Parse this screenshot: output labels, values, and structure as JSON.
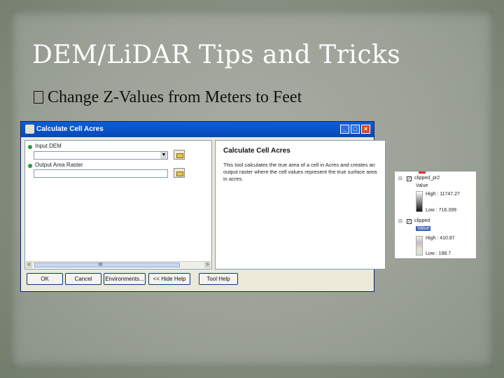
{
  "slide": {
    "title": "DEM/LiDAR Tips and Tricks",
    "bullet_mark": "",
    "bullet_text": "Change Z-Values from Meters to Feet"
  },
  "dialog": {
    "title": "Calculate Cell Acres",
    "window_buttons": [
      "_",
      "□",
      "×"
    ],
    "params": [
      {
        "label": "Input DEM",
        "value": "",
        "has_dropdown": true
      },
      {
        "label": "Output Area Raster",
        "value": "",
        "has_dropdown": false
      }
    ],
    "help": {
      "title": "Calculate Cell Acres",
      "text": "This tool calculates the true area of a cell in Acres and creates an output raster where the cell values represent the true surface area in acres."
    },
    "buttons": {
      "ok": "OK",
      "cancel": "Cancel",
      "environments": "Environments...",
      "hide_help": "<< Hide Help",
      "tool_help": "Tool Help"
    },
    "scroll_left": "<",
    "scroll_right": ">",
    "scroll_mid": "III"
  },
  "toc": {
    "layers": [
      {
        "name": "clipped_pr2",
        "checked": true,
        "field": "Value",
        "high": "High : 11747.27",
        "low": "Low : 716.399"
      },
      {
        "name": "clipped",
        "checked": true,
        "field": "Value",
        "high": "High : 410.87",
        "low": "Low : 188.7"
      }
    ]
  }
}
